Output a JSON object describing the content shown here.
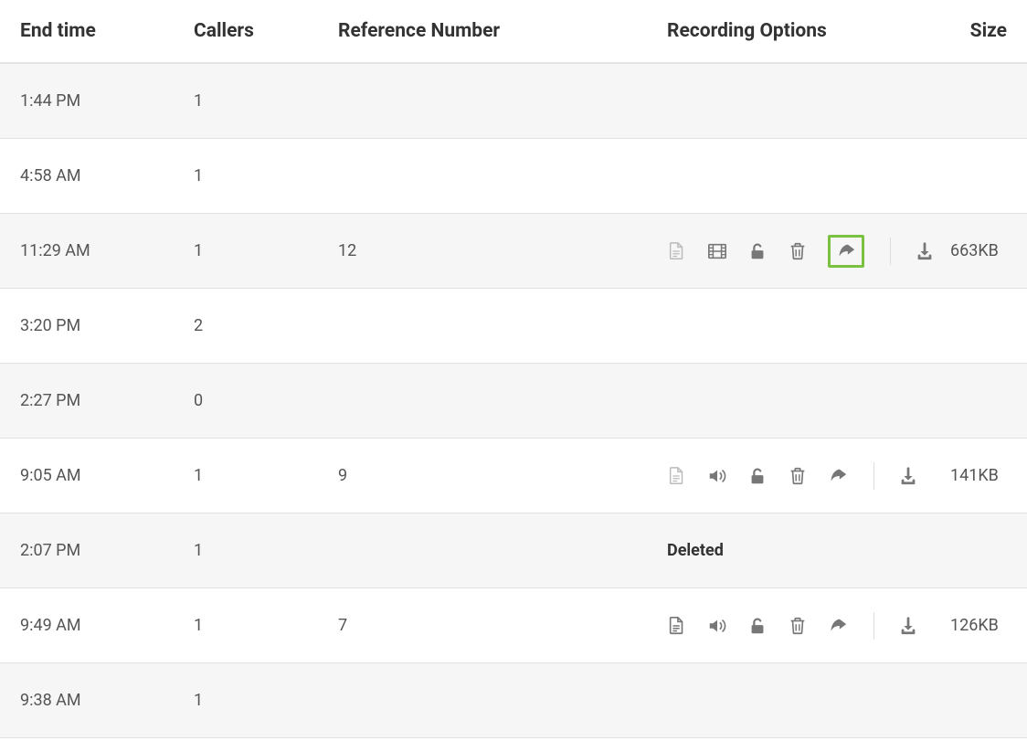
{
  "headers": {
    "end_time": "End time",
    "callers": "Callers",
    "reference": "Reference Number",
    "options": "Recording Options",
    "size": "Size"
  },
  "deleted_label": "Deleted",
  "rows": [
    {
      "end_time": "1:44 PM",
      "callers": "1",
      "reference": "",
      "size": ""
    },
    {
      "end_time": "4:58 AM",
      "callers": "1",
      "reference": "",
      "size": ""
    },
    {
      "end_time": "11:29 AM",
      "callers": "1",
      "reference": "12",
      "size": "663KB"
    },
    {
      "end_time": "3:20 PM",
      "callers": "2",
      "reference": "",
      "size": ""
    },
    {
      "end_time": "2:27 PM",
      "callers": "0",
      "reference": "",
      "size": ""
    },
    {
      "end_time": "9:05 AM",
      "callers": "1",
      "reference": "9",
      "size": "141KB"
    },
    {
      "end_time": "2:07 PM",
      "callers": "1",
      "reference": "",
      "size": ""
    },
    {
      "end_time": "9:49 AM",
      "callers": "1",
      "reference": "7",
      "size": "126KB"
    },
    {
      "end_time": "9:38 AM",
      "callers": "1",
      "reference": "",
      "size": ""
    }
  ]
}
